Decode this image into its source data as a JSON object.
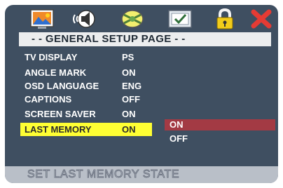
{
  "header": {
    "icons": [
      {
        "name": "general-setup-icon"
      },
      {
        "name": "audio-setup-icon"
      },
      {
        "name": "video-setup-icon"
      },
      {
        "name": "preference-icon"
      },
      {
        "name": "password-lock-icon"
      },
      {
        "name": "exit-icon"
      }
    ]
  },
  "page": {
    "title": "- - GENERAL SETUP PAGE - -"
  },
  "settings": [
    {
      "label": "TV DISPLAY",
      "value": "PS"
    },
    {
      "label": "ANGLE MARK",
      "value": "ON"
    },
    {
      "label": "OSD LANGUAGE",
      "value": "ENG"
    },
    {
      "label": "CAPTIONS",
      "value": "OFF"
    },
    {
      "label": "SCREEN SAVER",
      "value": "ON"
    },
    {
      "label": "LAST MEMORY",
      "value": "ON"
    }
  ],
  "options": [
    {
      "label": "ON",
      "selected": true
    },
    {
      "label": "OFF",
      "selected": false
    }
  ],
  "status": {
    "text": "SET LAST MEMORY STATE"
  },
  "colors": {
    "screen_bg": "#3f4f61",
    "highlight": "#ffff33",
    "selected_option": "#a33a44",
    "title_bar": "#ecedee",
    "status_bar": "#b9bfc8"
  }
}
